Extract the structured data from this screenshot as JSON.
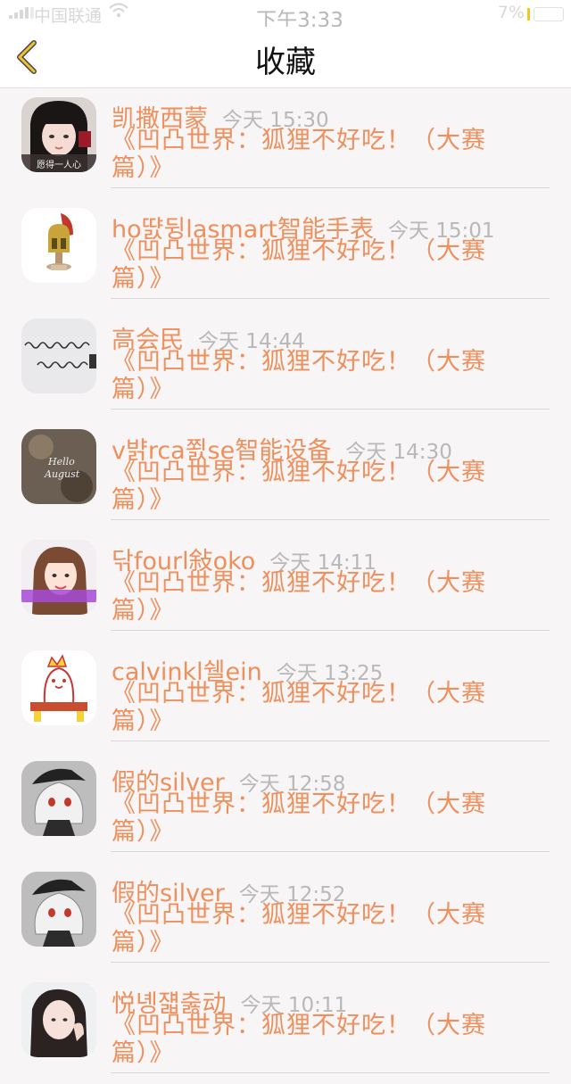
{
  "status_bar": {
    "carrier": "中国联通",
    "time": "下午3:33",
    "battery_percent": "7%",
    "battery_level": 0.07
  },
  "nav": {
    "title": "收藏",
    "back_icon": "chevron-left-icon",
    "accent": "#f2c230"
  },
  "colors": {
    "name": "#ee8f5c",
    "time": "#b8b8b8",
    "work": "#ee8f5c"
  },
  "favorites": [
    {
      "name": "凯撒西蒙",
      "time": "今天 15:30",
      "work": "《凹凸世界：狐狸不好吃！（大赛篇）》",
      "avatar": "avatar-girl-photo",
      "avatar_caption": "愿得一人心"
    },
    {
      "name": "ho땴뒹lasmart智能手表",
      "time": "今天 15:01",
      "work": "《凹凸世界：狐狸不好吃！（大赛篇）》",
      "avatar": "avatar-helmet-figurine"
    },
    {
      "name": "高会民",
      "time": "今天 14:44",
      "work": "《凹凸世界：狐狸不好吃！（大赛篇）》",
      "avatar": "avatar-handwriting"
    },
    {
      "name": "v뱕rca쬜se智能设备",
      "time": "今天 14:30",
      "work": "《凹凸世界：狐狸不好吃！（大赛篇）》",
      "avatar": "avatar-hello-august"
    },
    {
      "name": "닦fourl敍oko",
      "time": "今天 14:11",
      "work": "《凹凸世界：狐狸不好吃！（大赛篇）》",
      "avatar": "avatar-girl-smile"
    },
    {
      "name": "calvinkl쉘ein",
      "time": "今天 13:25",
      "work": "《凹凸世界：狐狸不好吃！（大赛篇）》",
      "avatar": "avatar-cartoon-sitting"
    },
    {
      "name": "假的silver",
      "time": "今天 12:58",
      "work": "《凹凸世界：狐狸不好吃！（大赛篇）》",
      "avatar": "avatar-anime-white-hair"
    },
    {
      "name": "假的silver",
      "time": "今天 12:52",
      "work": "《凹凸世界：狐狸不好吃！（大赛篇）》",
      "avatar": "avatar-anime-white-hair"
    },
    {
      "name": "悦녱쟯춣动",
      "time": "今天 10:11",
      "work": "《凹凸世界：狐狸不好吃！（大赛篇）》",
      "avatar": "avatar-girl-hand"
    }
  ]
}
